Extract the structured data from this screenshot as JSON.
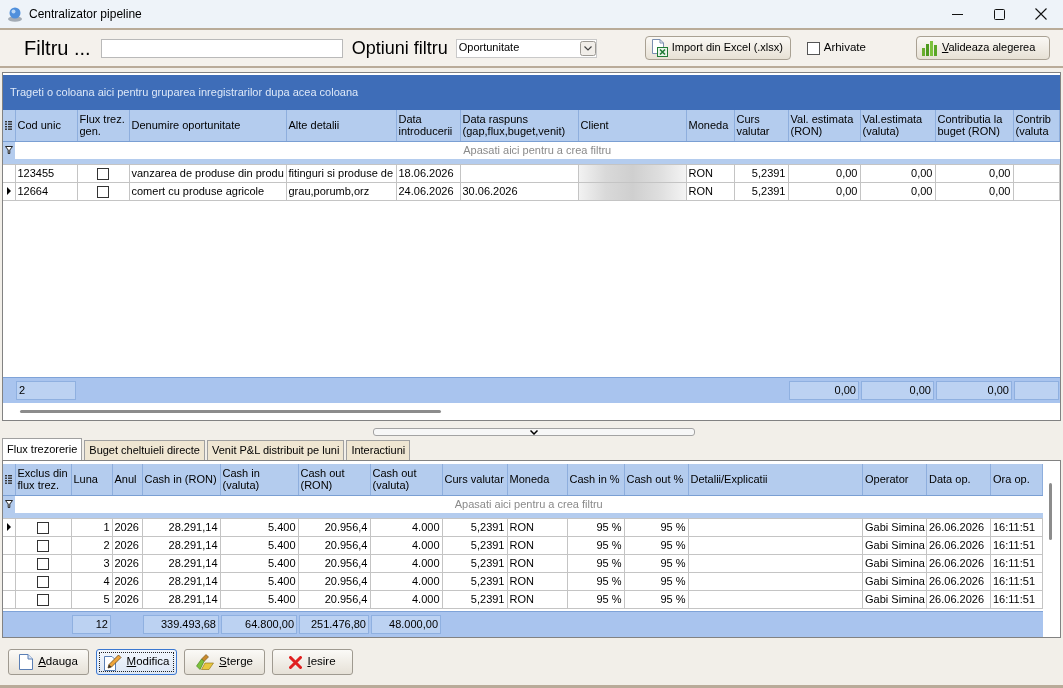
{
  "window": {
    "title": "Centralizator pipeline"
  },
  "toolbar": {
    "filter_label": "Filtru ...",
    "options_label": "Optiuni filtru",
    "options_value": "Oportunitate",
    "import_button": {
      "label": "Import din Excel (.xlsx)"
    },
    "archived": {
      "label": "Arhivate",
      "checked": false
    },
    "validate_button": {
      "label": "Valideaza alegerea"
    }
  },
  "upper_grid": {
    "group_panel_hint": "Trageti o coloana aici pentru gruparea inregistrarilor dupa acea coloana",
    "columns": [
      {
        "label": "Cod unic",
        "kind": "text",
        "total": "2"
      },
      {
        "label": "Flux trez. gen.",
        "kind": "check"
      },
      {
        "label": "Denumire oportunitate",
        "kind": "text"
      },
      {
        "label": "Alte detalii",
        "kind": "text"
      },
      {
        "label": "Data introducerii",
        "kind": "text"
      },
      {
        "label": "Data raspuns (gap,flux,buget,venit)",
        "kind": "text"
      },
      {
        "label": "Client",
        "kind": "blurred"
      },
      {
        "label": "Moneda",
        "kind": "text"
      },
      {
        "label": "Curs valutar",
        "kind": "number"
      },
      {
        "label": "Val. estimata (RON)",
        "kind": "number",
        "total": "0,00"
      },
      {
        "label": "Val.estimata (valuta)",
        "kind": "number",
        "total": "0,00"
      },
      {
        "label": "Contributia la buget (RON)",
        "kind": "number",
        "total": "0,00"
      },
      {
        "label": "Contrib (valuta",
        "kind": "number",
        "total_box": true
      }
    ],
    "filter_hint": "Apasati aici pentru a  crea filtru",
    "rows": [
      {
        "selected": false,
        "cod_unic": "123455",
        "flux_trez_gen": false,
        "denumire": "vanzarea de produse din produ",
        "alte_detalii": "fitinguri si produse de",
        "data_introducerii": "18.06.2026",
        "client_blurred": true,
        "moneda": "RON",
        "curs_valutar": "5,2391",
        "val_estimata_ron": "0,00",
        "val_estimata_valuta": "0,00",
        "contributia_ron": "0,00"
      },
      {
        "selected": true,
        "cod_unic": "12664",
        "flux_trez_gen": false,
        "denumire": "comert cu produse agricole",
        "alte_detalii": "grau,porumb,orz",
        "data_introducerii": "24.06.2026",
        "data_raspuns": "30.06.2026",
        "client_blurred": true,
        "moneda": "RON",
        "curs_valutar": "5,2391",
        "val_estimata_ron": "0,00",
        "val_estimata_valuta": "0,00",
        "contributia_ron": "0,00"
      }
    ]
  },
  "tabs": [
    {
      "label": "Flux trezorerie",
      "selected": true
    },
    {
      "label": "Buget cheltuieli directe",
      "selected": false
    },
    {
      "label": "Venit P&L distribuit pe luni",
      "selected": false
    },
    {
      "label": "Interactiuni",
      "selected": false
    }
  ],
  "lower_grid": {
    "columns": [
      {
        "label": "Exclus din flux trez.",
        "kind": "check"
      },
      {
        "label": "Luna",
        "kind": "number",
        "total": "12"
      },
      {
        "label": "Anul",
        "kind": "text"
      },
      {
        "label": "Cash in (RON)",
        "kind": "number",
        "total": "339.493,68"
      },
      {
        "label": "Cash in (valuta)",
        "kind": "number",
        "total": "64.800,00"
      },
      {
        "label": "Cash out (RON)",
        "kind": "number",
        "total": "251.476,80"
      },
      {
        "label": "Cash out (valuta)",
        "kind": "number",
        "total": "48.000,00"
      },
      {
        "label": "Curs valutar",
        "kind": "number"
      },
      {
        "label": "Moneda",
        "kind": "text"
      },
      {
        "label": "Cash in %",
        "kind": "number"
      },
      {
        "label": "Cash out %",
        "kind": "number"
      },
      {
        "label": "Detalii/Explicatii",
        "kind": "text"
      },
      {
        "label": "Operator",
        "kind": "text"
      },
      {
        "label": "Data op.",
        "kind": "text"
      },
      {
        "label": "Ora op.",
        "kind": "text"
      }
    ],
    "filter_hint": "Apasati aici pentru a  crea filtru",
    "rows": [
      {
        "selected": true,
        "exclus": false,
        "luna": "1",
        "anul": "2026",
        "cash_in_ron": "28.291,14",
        "cash_in_valuta": "5.400",
        "cash_out_ron": "20.956,4",
        "cash_out_valuta": "4.000",
        "curs_valutar": "5,2391",
        "moneda": "RON",
        "cash_in_pct": "95 %",
        "cash_out_pct": "95 %",
        "operator": "Gabi Simina",
        "data_op": "26.06.2026",
        "ora_op": "16:11:51"
      },
      {
        "selected": false,
        "exclus": false,
        "luna": "2",
        "anul": "2026",
        "cash_in_ron": "28.291,14",
        "cash_in_valuta": "5.400",
        "cash_out_ron": "20.956,4",
        "cash_out_valuta": "4.000",
        "curs_valutar": "5,2391",
        "moneda": "RON",
        "cash_in_pct": "95 %",
        "cash_out_pct": "95 %",
        "operator": "Gabi Simina",
        "data_op": "26.06.2026",
        "ora_op": "16:11:51"
      },
      {
        "selected": false,
        "exclus": false,
        "luna": "3",
        "anul": "2026",
        "cash_in_ron": "28.291,14",
        "cash_in_valuta": "5.400",
        "cash_out_ron": "20.956,4",
        "cash_out_valuta": "4.000",
        "curs_valutar": "5,2391",
        "moneda": "RON",
        "cash_in_pct": "95 %",
        "cash_out_pct": "95 %",
        "operator": "Gabi Simina",
        "data_op": "26.06.2026",
        "ora_op": "16:11:51"
      },
      {
        "selected": false,
        "exclus": false,
        "luna": "4",
        "anul": "2026",
        "cash_in_ron": "28.291,14",
        "cash_in_valuta": "5.400",
        "cash_out_ron": "20.956,4",
        "cash_out_valuta": "4.000",
        "curs_valutar": "5,2391",
        "moneda": "RON",
        "cash_in_pct": "95 %",
        "cash_out_pct": "95 %",
        "operator": "Gabi Simina",
        "data_op": "26.06.2026",
        "ora_op": "16:11:51"
      },
      {
        "selected": false,
        "exclus": false,
        "luna": "5",
        "anul": "2026",
        "cash_in_ron": "28.291,14",
        "cash_in_valuta": "5.400",
        "cash_out_ron": "20.956,4",
        "cash_out_valuta": "4.000",
        "curs_valutar": "5,2391",
        "moneda": "RON",
        "cash_in_pct": "95 %",
        "cash_out_pct": "95 %",
        "operator": "Gabi Simina",
        "data_op": "26.06.2026",
        "ora_op": "16:11:51"
      }
    ]
  },
  "buttons": [
    {
      "kind": "add",
      "label": "Adauga",
      "focused": false
    },
    {
      "kind": "edit",
      "label": "Modifica",
      "focused": true
    },
    {
      "kind": "delete",
      "label": "Sterge",
      "focused": false
    },
    {
      "kind": "exit",
      "label": "Iesire",
      "focused": false
    }
  ]
}
